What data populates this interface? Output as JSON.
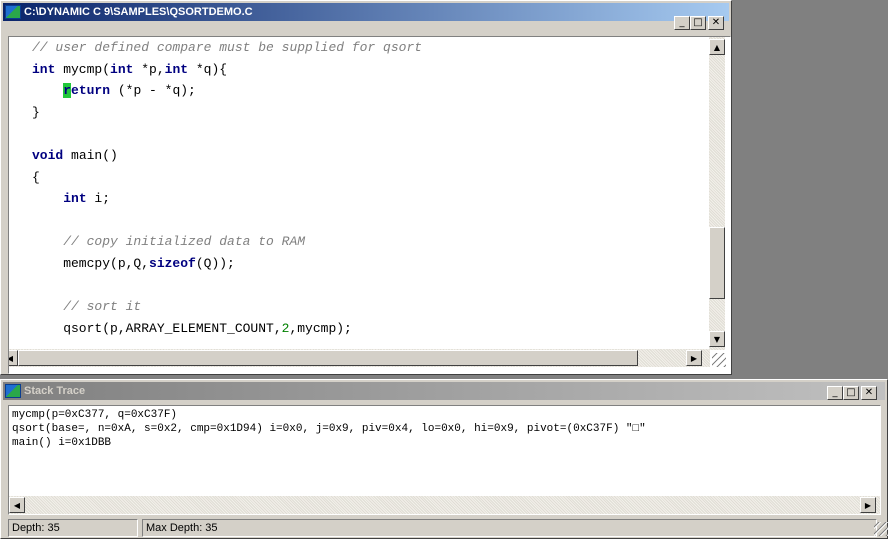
{
  "editor": {
    "title": "C:\\DYNAMIC C 9\\SAMPLES\\QSORTDEMO.C",
    "code_lines": [
      {
        "segments": [
          {
            "t": "// user defined compare must be supplied for qsort",
            "c": "cm"
          }
        ]
      },
      {
        "segments": [
          {
            "t": "int",
            "c": "kw"
          },
          {
            "t": " mycmp("
          },
          {
            "t": "int",
            "c": "kw"
          },
          {
            "t": " *p,"
          },
          {
            "t": "int",
            "c": "kw"
          },
          {
            "t": " *q){"
          }
        ]
      },
      {
        "segments": [
          {
            "t": "    "
          },
          {
            "t": "r",
            "c": "cursor kw"
          },
          {
            "t": "eturn",
            "c": "kw"
          },
          {
            "t": " (*p - *q);"
          }
        ]
      },
      {
        "segments": [
          {
            "t": "}"
          }
        ]
      },
      {
        "segments": [
          {
            "t": ""
          }
        ]
      },
      {
        "segments": [
          {
            "t": "void",
            "c": "kw"
          },
          {
            "t": " main()"
          }
        ]
      },
      {
        "segments": [
          {
            "t": "{"
          }
        ]
      },
      {
        "segments": [
          {
            "t": "    "
          },
          {
            "t": "int",
            "c": "kw"
          },
          {
            "t": " i;"
          }
        ]
      },
      {
        "segments": [
          {
            "t": ""
          }
        ]
      },
      {
        "segments": [
          {
            "t": "    "
          },
          {
            "t": "// copy initialized data to RAM",
            "c": "cm"
          }
        ]
      },
      {
        "segments": [
          {
            "t": "    memcpy(p,Q,"
          },
          {
            "t": "sizeof",
            "c": "kw"
          },
          {
            "t": "(Q));"
          }
        ]
      },
      {
        "segments": [
          {
            "t": ""
          }
        ]
      },
      {
        "segments": [
          {
            "t": "    "
          },
          {
            "t": "// sort it",
            "c": "cm"
          }
        ]
      },
      {
        "segments": [
          {
            "t": "    qsort(p,ARRAY_ELEMENT_COUNT,"
          },
          {
            "t": "2",
            "c": "num"
          },
          {
            "t": ",mycmp);"
          }
        ]
      }
    ]
  },
  "stack_trace": {
    "title": "Stack Trace",
    "lines": [
      "mycmp(p=0xC377, q=0xC37F)",
      "qsort(base=, n=0xA, s=0x2, cmp=0x1D94) i=0x0, j=0x9, piv=0x4, lo=0x0, hi=0x9, pivot=(0xC37F) \"□\"",
      "main() i=0x1DBB"
    ]
  },
  "status": {
    "depth": "Depth: 35",
    "max_depth": "Max Depth: 35"
  },
  "controls": {
    "minimize": "_",
    "maximize": "□",
    "close": "✕",
    "up": "▲",
    "down": "▼",
    "left": "◀",
    "right": "▶"
  },
  "scroll_state": {
    "editor_vertical_position": 0.75,
    "editor_horizontal_position": 0.0
  }
}
